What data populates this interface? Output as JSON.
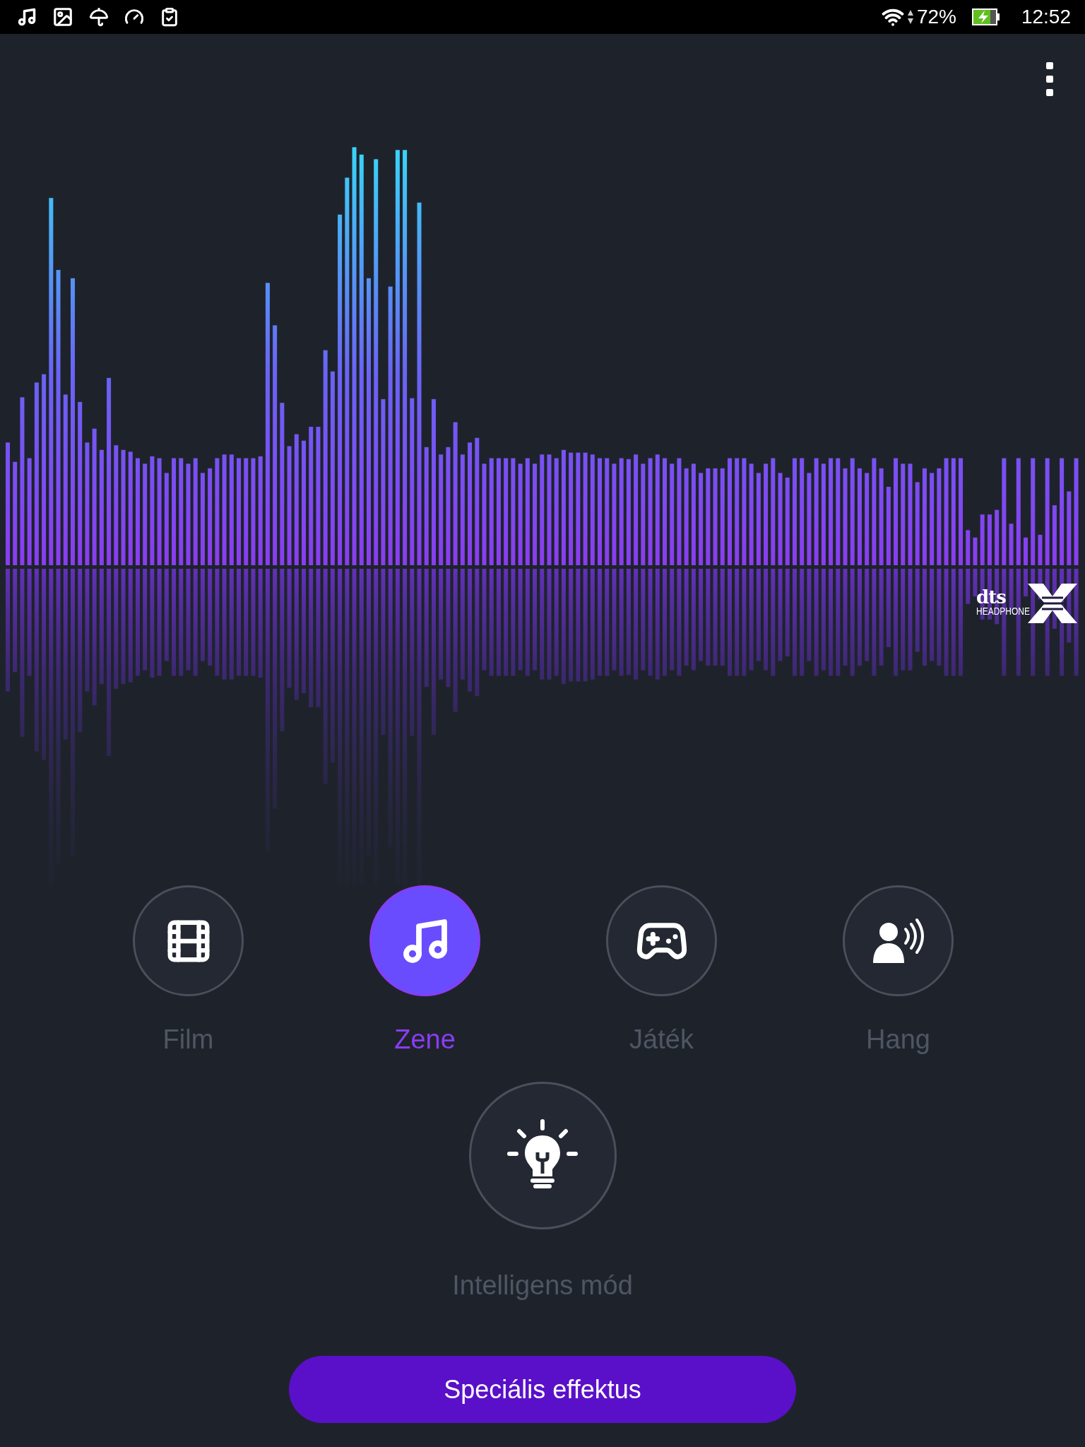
{
  "status_bar": {
    "battery": "72%",
    "time": "12:52"
  },
  "visualizer": {
    "logo": {
      "brand": "dts",
      "product": "HEADPHONE"
    }
  },
  "modes": [
    {
      "kind": "film",
      "label": "Film",
      "selected": false
    },
    {
      "kind": "music",
      "label": "Zene",
      "selected": true
    },
    {
      "kind": "game",
      "label": "Játék",
      "selected": false
    },
    {
      "kind": "voice",
      "label": "Hang",
      "selected": false
    }
  ],
  "smart_mode": {
    "label": "Intelligens mód",
    "selected": false
  },
  "effects_button": {
    "label": "Speciális effektus"
  }
}
